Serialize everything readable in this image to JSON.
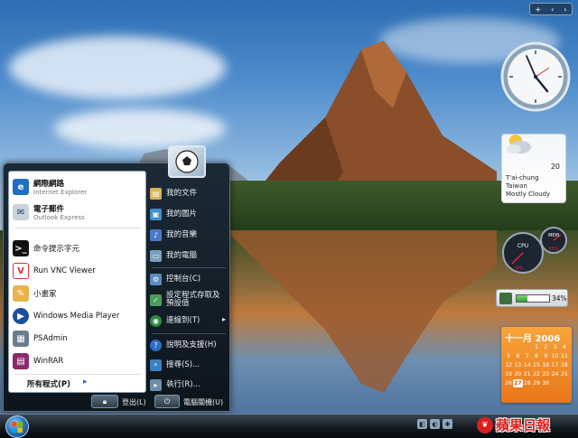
{
  "start_menu": {
    "pinned": [
      {
        "title": "網際網路",
        "subtitle": "Internet Explorer",
        "icon": "ie-icon"
      },
      {
        "title": "電子郵件",
        "subtitle": "Outlook Express",
        "icon": "mail-icon"
      }
    ],
    "recent": [
      {
        "label": "命令提示字元",
        "icon": "cmd-icon"
      },
      {
        "label": "Run VNC Viewer",
        "icon": "vnc-icon"
      },
      {
        "label": "小畫家",
        "icon": "paint-icon"
      },
      {
        "label": "Windows Media Player",
        "icon": "media-player-icon"
      },
      {
        "label": "PSAdmin",
        "icon": "psadmin-icon"
      },
      {
        "label": "WinRAR",
        "icon": "winrar-icon"
      }
    ],
    "all_programs": "所有程式(P)",
    "right_items": [
      {
        "label": "我的文件",
        "icon": "documents-icon"
      },
      {
        "label": "我的圖片",
        "icon": "pictures-icon"
      },
      {
        "label": "我的音樂",
        "icon": "music-icon"
      },
      {
        "label": "我的電腦",
        "icon": "computer-icon"
      },
      {
        "label": "控制台(C)",
        "icon": "control-panel-icon"
      },
      {
        "label": "設定程式存取及預設值",
        "icon": "defaults-icon"
      },
      {
        "label": "連線到(T)",
        "icon": "connect-icon"
      },
      {
        "label": "說明及支援(H)",
        "icon": "help-icon"
      },
      {
        "label": "搜尋(S)...",
        "icon": "search-icon"
      },
      {
        "label": "執行(R)...",
        "icon": "run-icon"
      }
    ],
    "logoff": "登出(L)",
    "shutdown": "電腦關機(U)"
  },
  "gadgets": {
    "weather": {
      "temp": "20",
      "city": "T'ai-chung",
      "country": "Taiwan",
      "condition": "Mostly Cloudy"
    },
    "cpu_meter": {
      "cpu_label": "CPU",
      "mem_label": "MEM",
      "cpu_value": "0%",
      "mem_value": "65%"
    },
    "battery": {
      "percent": "34%",
      "level": 0.34
    },
    "calendar": {
      "header": "十一月 2006",
      "days": [
        "",
        "",
        "",
        "1",
        "2",
        "3",
        "4",
        "5",
        "6",
        "7",
        "8",
        "9",
        "10",
        "11",
        "12",
        "13",
        "14",
        "15",
        "16",
        "17",
        "18",
        "19",
        "20",
        "21",
        "22",
        "23",
        "24",
        "25",
        "26",
        "27",
        "28",
        "29",
        "30",
        "",
        ""
      ],
      "today": "27"
    }
  },
  "watermark": {
    "text": "蘋果日報"
  },
  "colors": {
    "menu_bg": "#0d141b",
    "accent": "#2d7ac4",
    "calendar": "#e8761a",
    "watermark": "#e02020"
  }
}
